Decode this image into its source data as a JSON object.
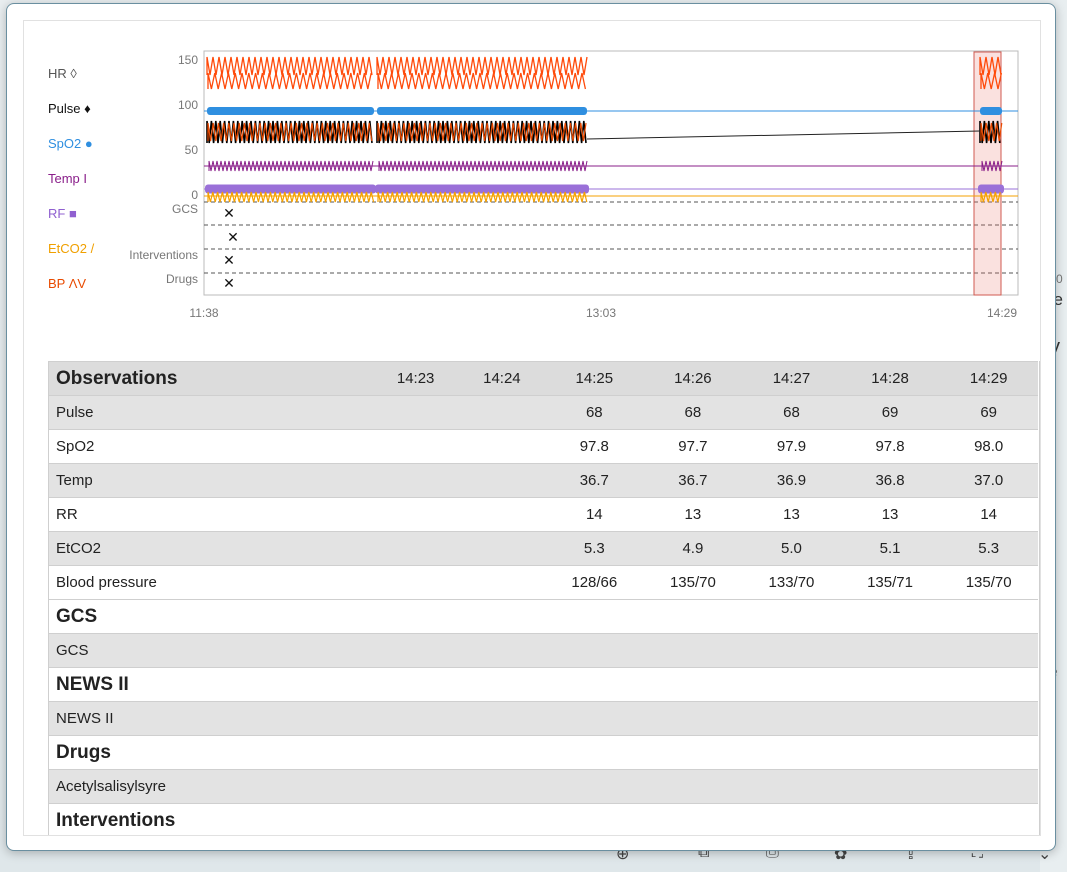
{
  "legend": [
    {
      "label": "HR ◊",
      "color": "#555555"
    },
    {
      "label": "Pulse ♦",
      "color": "#111111"
    },
    {
      "label": "SpO2 ●",
      "color": "#2f8fe0"
    },
    {
      "label": "Temp I",
      "color": "#8a1f8a"
    },
    {
      "label": "RF ■",
      "color": "#9060d0"
    },
    {
      "label": "EtCO2 /",
      "color": "#f0a000"
    },
    {
      "label": "BP ΛV",
      "color": "#e84a00"
    }
  ],
  "chart_data": {
    "type": "line",
    "y_ticks": [
      "150",
      "100",
      "50",
      "0"
    ],
    "ylim": [
      0,
      160
    ],
    "x_ticks": [
      "11:38",
      "13:03",
      "14:29"
    ],
    "lanes": [
      "GCS",
      "Interventions",
      "Drugs"
    ],
    "series_colors": {
      "hr": "#ff4a0a",
      "pulse": "#000000",
      "spo2": "#2f8fe0",
      "temp": "#8a1f8a",
      "rf": "#9a70d8",
      "etco2": "#f5a100",
      "bp": "#e84a00"
    },
    "series": [
      {
        "name": "Pulse",
        "values": [
          68,
          68,
          68,
          69,
          69
        ]
      },
      {
        "name": "SpO2",
        "values": [
          97.8,
          97.7,
          97.9,
          97.8,
          98.0
        ]
      },
      {
        "name": "Temp",
        "values": [
          36.7,
          36.7,
          36.9,
          36.8,
          37.0
        ]
      },
      {
        "name": "RR",
        "values": [
          14,
          13,
          13,
          13,
          14
        ]
      },
      {
        "name": "EtCO2",
        "values": [
          5.3,
          4.9,
          5.0,
          5.1,
          5.3
        ]
      },
      {
        "name": "Blood pressure",
        "values": [
          "128/66",
          "135/70",
          "133/70",
          "135/71",
          "135/70"
        ]
      }
    ]
  },
  "table": {
    "times": [
      "14:23",
      "14:24",
      "14:25",
      "14:26",
      "14:27",
      "14:28",
      "14:29"
    ],
    "sections": [
      {
        "title": "Observations",
        "rows": [
          {
            "label": "Pulse",
            "values": [
              "",
              "",
              "68",
              "68",
              "68",
              "69",
              "69"
            ]
          },
          {
            "label": "SpO2",
            "values": [
              "",
              "",
              "97.8",
              "97.7",
              "97.9",
              "97.8",
              "98.0"
            ]
          },
          {
            "label": "Temp",
            "values": [
              "",
              "",
              "36.7",
              "36.7",
              "36.9",
              "36.8",
              "37.0"
            ]
          },
          {
            "label": "RR",
            "values": [
              "",
              "",
              "14",
              "13",
              "13",
              "13",
              "14"
            ]
          },
          {
            "label": "EtCO2",
            "values": [
              "",
              "",
              "5.3",
              "4.9",
              "5.0",
              "5.1",
              "5.3"
            ]
          },
          {
            "label": "Blood pressure",
            "values": [
              "",
              "",
              "128/66",
              "135/70",
              "133/70",
              "135/71",
              "135/70"
            ]
          }
        ]
      },
      {
        "title": "GCS",
        "rows": [
          {
            "label": "GCS",
            "values": [
              "",
              "",
              "",
              "",
              "",
              "",
              ""
            ]
          }
        ]
      },
      {
        "title": "NEWS II",
        "rows": [
          {
            "label": "NEWS II",
            "values": [
              "",
              "",
              "",
              "",
              "",
              "",
              ""
            ]
          }
        ]
      },
      {
        "title": "Drugs",
        "rows": [
          {
            "label": "Acetylsalisylsyre",
            "values": [
              "",
              "",
              "",
              "",
              "",
              "",
              ""
            ]
          }
        ]
      },
      {
        "title": "Interventions",
        "rows": []
      }
    ]
  },
  "background": {
    "right_fragments": [
      "he",
      "y",
      "e",
      "0"
    ]
  }
}
